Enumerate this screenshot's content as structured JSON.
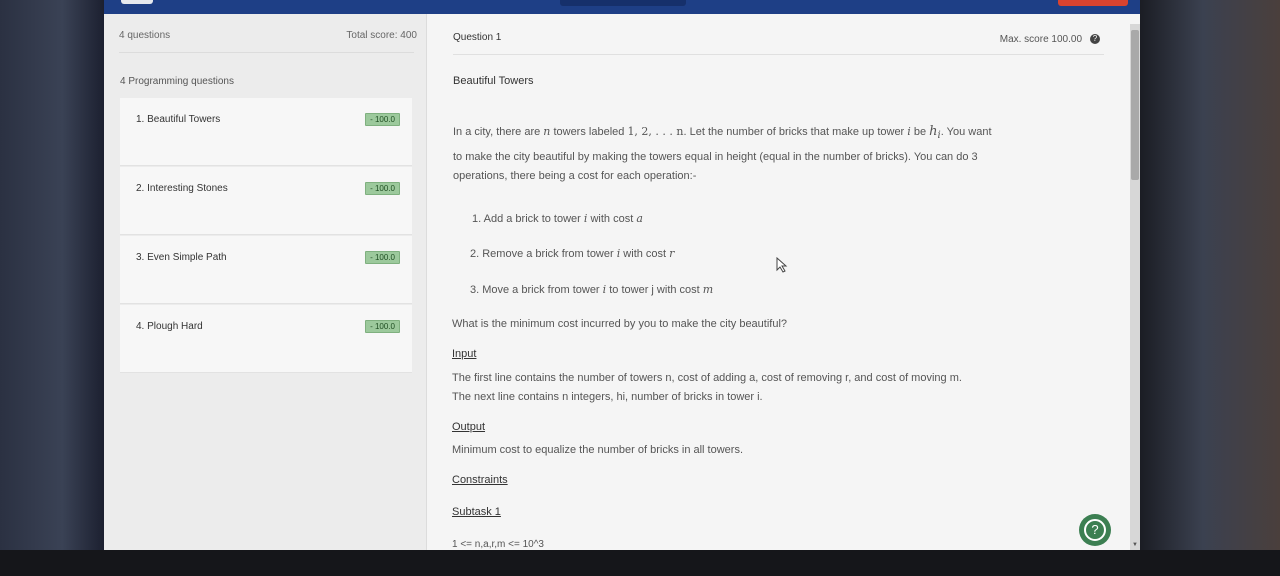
{
  "left_panel": {
    "questions_count": "4 questions",
    "total_score": "Total score: 400",
    "section_label": "4 Programming questions",
    "questions": [
      {
        "label": "1. Beautiful Towers",
        "score": "- 100.0"
      },
      {
        "label": "2. Interesting Stones",
        "score": "- 100.0"
      },
      {
        "label": "3. Even Simple Path",
        "score": "- 100.0"
      },
      {
        "label": "4. Plough Hard",
        "score": "- 100.0"
      }
    ]
  },
  "question": {
    "header": "Question  1",
    "max_score": "Max. score 100.00",
    "help_icon": "?",
    "title": "Beautiful Towers",
    "intro": {
      "t1": "In a city, there are ",
      "m_n": "n",
      "t2": " towers labeled ",
      "m_labels": "1, 2, . . . n",
      "t3": ". Let the number of bricks that make up tower ",
      "m_i": "i",
      "t4": " be ",
      "m_h": "h",
      "m_hi": "i",
      "t5": ". You want"
    },
    "line2": "to make the city beautiful by making the towers equal in height (equal in the number of bricks). You can do 3",
    "line3": "operations, there being a cost for each operation:-",
    "ops": [
      {
        "text": "1. Add a brick to tower ",
        "var": "i",
        "mid": " with cost ",
        "cost": "a"
      },
      {
        "text": "2. Remove a brick from tower ",
        "var": "i",
        "mid": " with cost ",
        "cost": "r"
      },
      {
        "text": "3. Move a brick from tower ",
        "var": "i",
        "mid": " to tower j with cost ",
        "cost": "m"
      }
    ],
    "question_text": "What is the minimum cost incurred by you to make the city beautiful?",
    "input_heading": "Input",
    "input_line1": "The first line contains the number of towers n, cost of adding a, cost of removing r, and cost of moving m.",
    "input_line2": "The next line contains n integers, hi, number of bricks in tower i.",
    "output_heading": "Output",
    "output_line": "Minimum cost to equalize the number of bricks in all towers.",
    "constraints_heading": "Constraints",
    "subtask_heading": "Subtask 1",
    "subtask_line": "1 <= n,a,r,m <= 10^3"
  },
  "help_button": "?",
  "colors": {
    "topbar": "#1e3f86",
    "badge_green": "#9cc99c",
    "help_green": "#3c7f52",
    "alert_red": "#d9432f"
  }
}
